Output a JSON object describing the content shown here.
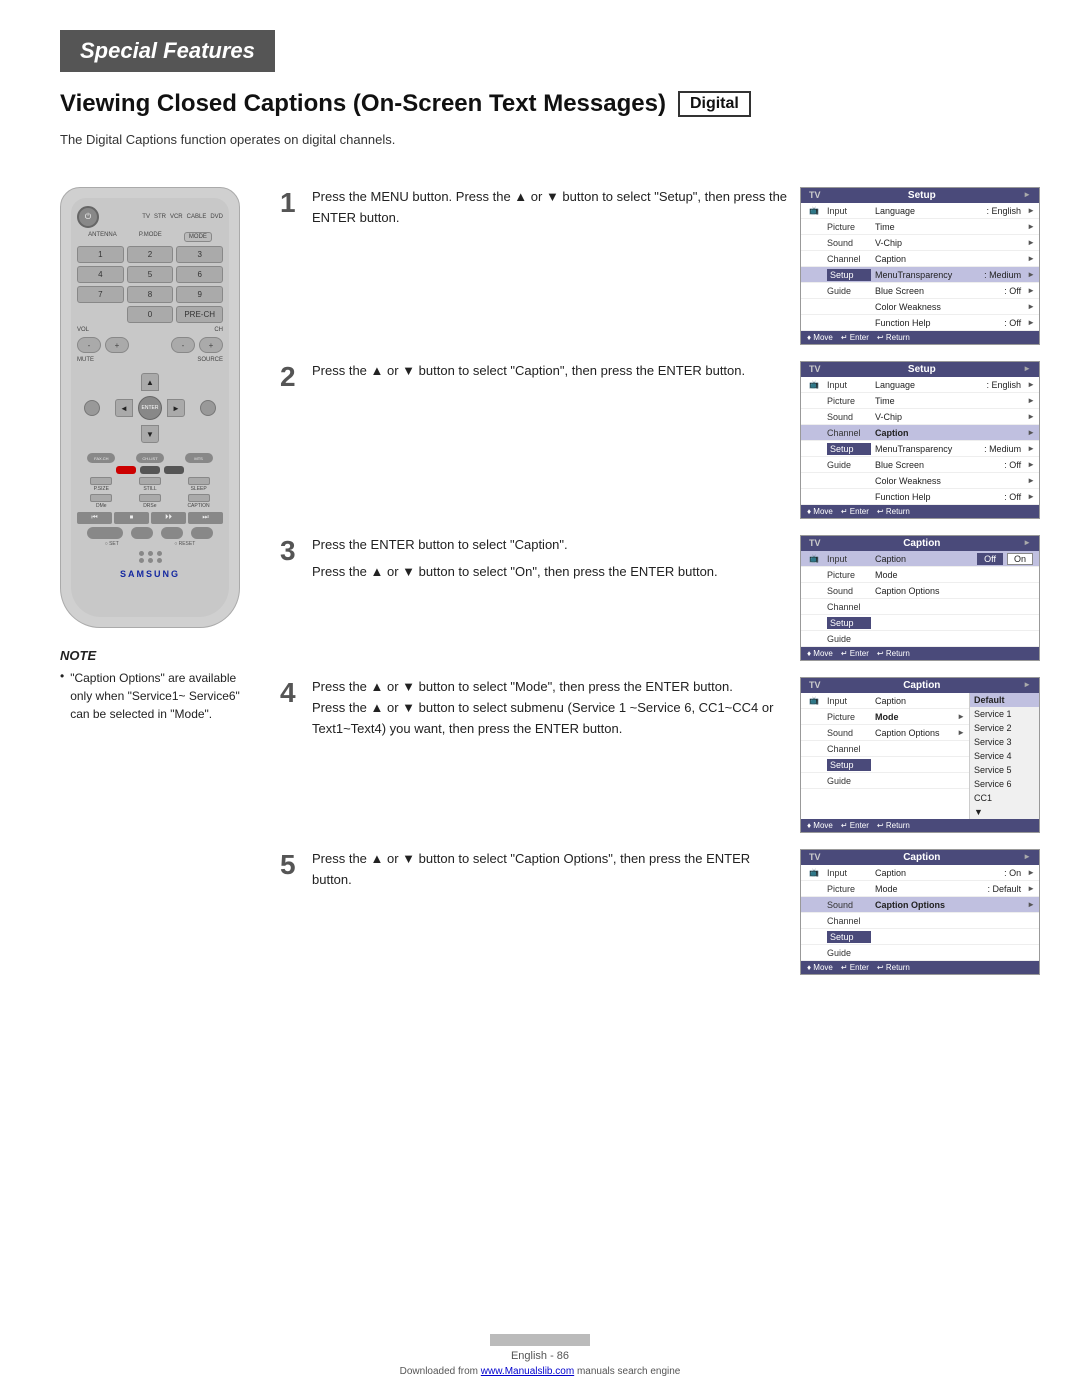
{
  "header": {
    "section_label": "Special Features",
    "title": "Viewing Closed Captions (On-Screen Text Messages)",
    "badge": "Digital",
    "subtitle": "The Digital Captions function operates on digital channels."
  },
  "steps": [
    {
      "number": "1",
      "text": "Press the MENU button.\nPress the ▲ or ▼ button to select \"Setup\", then press the ENTER button."
    },
    {
      "number": "2",
      "text": "Press the ▲ or ▼ button to select \"Caption\", then press the ENTER button."
    },
    {
      "number": "3",
      "text_part1": "Press the ENTER button to select \"Caption\".",
      "text_part2": "Press the ▲ or ▼ button to select \"On\", then press the ENTER button."
    },
    {
      "number": "4",
      "text": "Press the ▲ or ▼ button to select \"Mode\", then press the ENTER button.\nPress the ▲ or ▼ button to select submenu (Service 1 ~Service 6, CC1~CC4 or Text1~Text4) you want, then press the ENTER button."
    },
    {
      "number": "5",
      "text": "Press the ▲ or ▼ button to select \"Caption Options\", then press the ENTER button."
    }
  ],
  "screens": {
    "setup1": {
      "tv_label": "TV",
      "title": "Setup",
      "sidebar": [
        "Input",
        "Picture",
        "Sound",
        "Channel",
        "Setup",
        "Guide"
      ],
      "active_item": "Setup",
      "rows": [
        {
          "name": "Language",
          "value": ": English",
          "arrow": "►"
        },
        {
          "name": "Time",
          "value": "",
          "arrow": "►"
        },
        {
          "name": "V-Chip",
          "value": "",
          "arrow": "►"
        },
        {
          "name": "Caption",
          "value": "",
          "arrow": "►"
        },
        {
          "name": "MenuTransparency",
          "value": ": Medium",
          "arrow": "►"
        },
        {
          "name": "Blue Screen",
          "value": ": Off",
          "arrow": "►"
        },
        {
          "name": "Color Weakness",
          "value": "",
          "arrow": "►"
        },
        {
          "name": "Function Help",
          "value": ": Off",
          "arrow": "►"
        }
      ],
      "footer": [
        "♦ Move",
        "↵ Enter",
        "↩ Return"
      ]
    },
    "setup2": {
      "tv_label": "TV",
      "title": "Setup",
      "sidebar": [
        "Input",
        "Picture",
        "Sound",
        "Channel",
        "Setup",
        "Guide"
      ],
      "active_item": "Setup",
      "rows": [
        {
          "name": "Language",
          "value": ": English",
          "arrow": "►"
        },
        {
          "name": "Time",
          "value": "",
          "arrow": "►"
        },
        {
          "name": "V-Chip",
          "value": "",
          "arrow": "►"
        },
        {
          "name": "Caption",
          "value": "",
          "arrow": "►",
          "selected": true
        },
        {
          "name": "MenuTransparency",
          "value": ": Medium",
          "arrow": "►"
        },
        {
          "name": "Blue Screen",
          "value": ": Off",
          "arrow": "►"
        },
        {
          "name": "Color Weakness",
          "value": "",
          "arrow": "►"
        },
        {
          "name": "Function Help",
          "value": ": Off",
          "arrow": "►"
        }
      ],
      "footer": [
        "♦ Move",
        "↵ Enter",
        "↩ Return"
      ]
    },
    "caption1": {
      "tv_label": "TV",
      "title": "Caption",
      "sidebar": [
        "Input",
        "Picture",
        "Sound",
        "Channel",
        "Setup",
        "Guide"
      ],
      "active_item": "Setup",
      "rows": [
        {
          "name": "Caption",
          "value": "",
          "options": [
            "Off",
            "On"
          ],
          "selected_option": 0
        },
        {
          "name": "Mode",
          "value": "",
          "arrow": ""
        },
        {
          "name": "Caption Options",
          "value": "",
          "arrow": ""
        }
      ],
      "footer": [
        "♦ Move",
        "↵ Enter",
        "↩ Return"
      ]
    },
    "caption2": {
      "tv_label": "TV",
      "title": "Caption",
      "sidebar": [
        "Input",
        "Picture",
        "Sound",
        "Channel",
        "Setup",
        "Guide"
      ],
      "active_item": "Setup",
      "rows": [
        {
          "name": "Caption",
          "value": "",
          "arrow": ""
        },
        {
          "name": "Mode",
          "value": "",
          "arrow": "►",
          "selected": true
        },
        {
          "name": "Caption Options",
          "value": "",
          "arrow": "►"
        }
      ],
      "submenu": [
        "Default",
        "Service 1",
        "Service 2",
        "Service 3",
        "Service 4",
        "Service 5",
        "Service 6",
        "CC1"
      ],
      "footer": [
        "♦ Move",
        "↵ Enter",
        "↩ Return"
      ]
    },
    "caption3": {
      "tv_label": "TV",
      "title": "Caption",
      "sidebar": [
        "Input",
        "Picture",
        "Sound",
        "Channel",
        "Setup",
        "Guide"
      ],
      "active_item": "Setup",
      "rows": [
        {
          "name": "Caption",
          "value": ": On",
          "arrow": "►"
        },
        {
          "name": "Mode",
          "value": ": Default",
          "arrow": "►"
        },
        {
          "name": "Caption Options",
          "value": "",
          "arrow": "►",
          "selected": true
        }
      ],
      "footer": [
        "♦ Move",
        "↵ Enter",
        "↩ Return"
      ]
    }
  },
  "note": {
    "title": "NOTE",
    "bullets": [
      "\"Caption Options\" are available only when \"Service1~ Service6\" can be selected in \"Mode\"."
    ]
  },
  "footer": {
    "text": "English - 86",
    "download_text": "Downloaded from ",
    "download_link_text": "www.Manualslib.com",
    "download_suffix": " manuals search engine"
  }
}
